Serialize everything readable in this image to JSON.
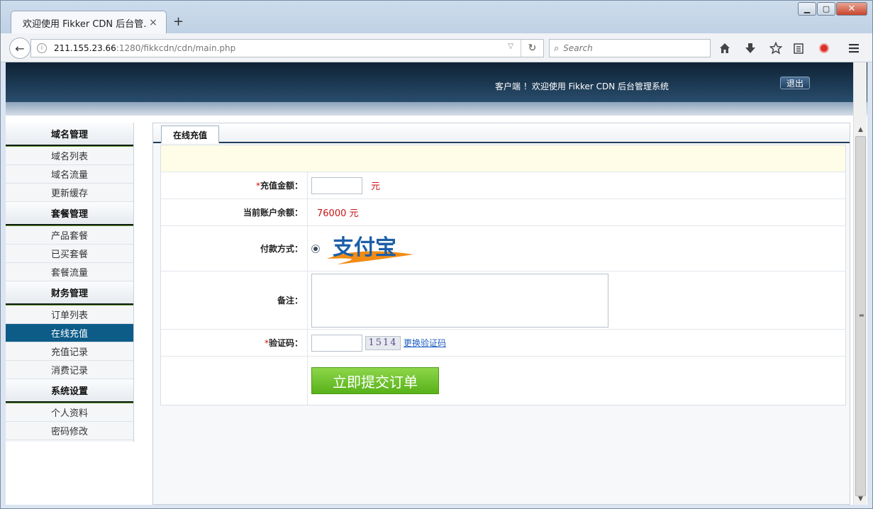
{
  "browser": {
    "tab_title": "欢迎使用 Fikker CDN 后台管...",
    "tab_close": "×",
    "new_tab": "+",
    "url_host": "211.155.23.66",
    "url_path": ":1280/fikkcdn/cdn/main.php",
    "search_placeholder": "Search"
  },
  "header": {
    "welcome": "客户端 ！欢迎使用 Fikker CDN 后台管理系统",
    "logout": "退出"
  },
  "sidebar": {
    "sections": [
      {
        "title": "域名管理",
        "items": [
          "域名列表",
          "域名流量",
          "更新缓存"
        ]
      },
      {
        "title": "套餐管理",
        "items": [
          "产品套餐",
          "已买套餐",
          "套餐流量"
        ]
      },
      {
        "title": "财务管理",
        "items": [
          "订单列表",
          "在线充值",
          "充值记录",
          "消费记录"
        ]
      },
      {
        "title": "系统设置",
        "items": [
          "个人资料",
          "密码修改"
        ]
      }
    ],
    "active_item": "在线充值"
  },
  "panel": {
    "tab": "在线充值"
  },
  "form": {
    "required_mark": "*",
    "amount_label": "充值金额：",
    "amount_value": "",
    "amount_unit": "元",
    "balance_label": "当前账户余额：",
    "balance_value": "76000 元",
    "payment_label": "付款方式：",
    "payment_selected": true,
    "logo_text": "支付宝",
    "remark_label": "备注：",
    "remark_value": "",
    "captcha_label": "验证码：",
    "captcha_value": "",
    "captcha_code": "1514",
    "captcha_refresh": "更换验证码",
    "submit": "立即提交订单"
  },
  "colors": {
    "header_bg": "#1d3b56",
    "active_menu": "#0d5c88",
    "accent_red": "#c81414",
    "submit_green": "#58b21a",
    "alipay_blue": "#1d5fa8",
    "alipay_orange": "#f28c14"
  }
}
